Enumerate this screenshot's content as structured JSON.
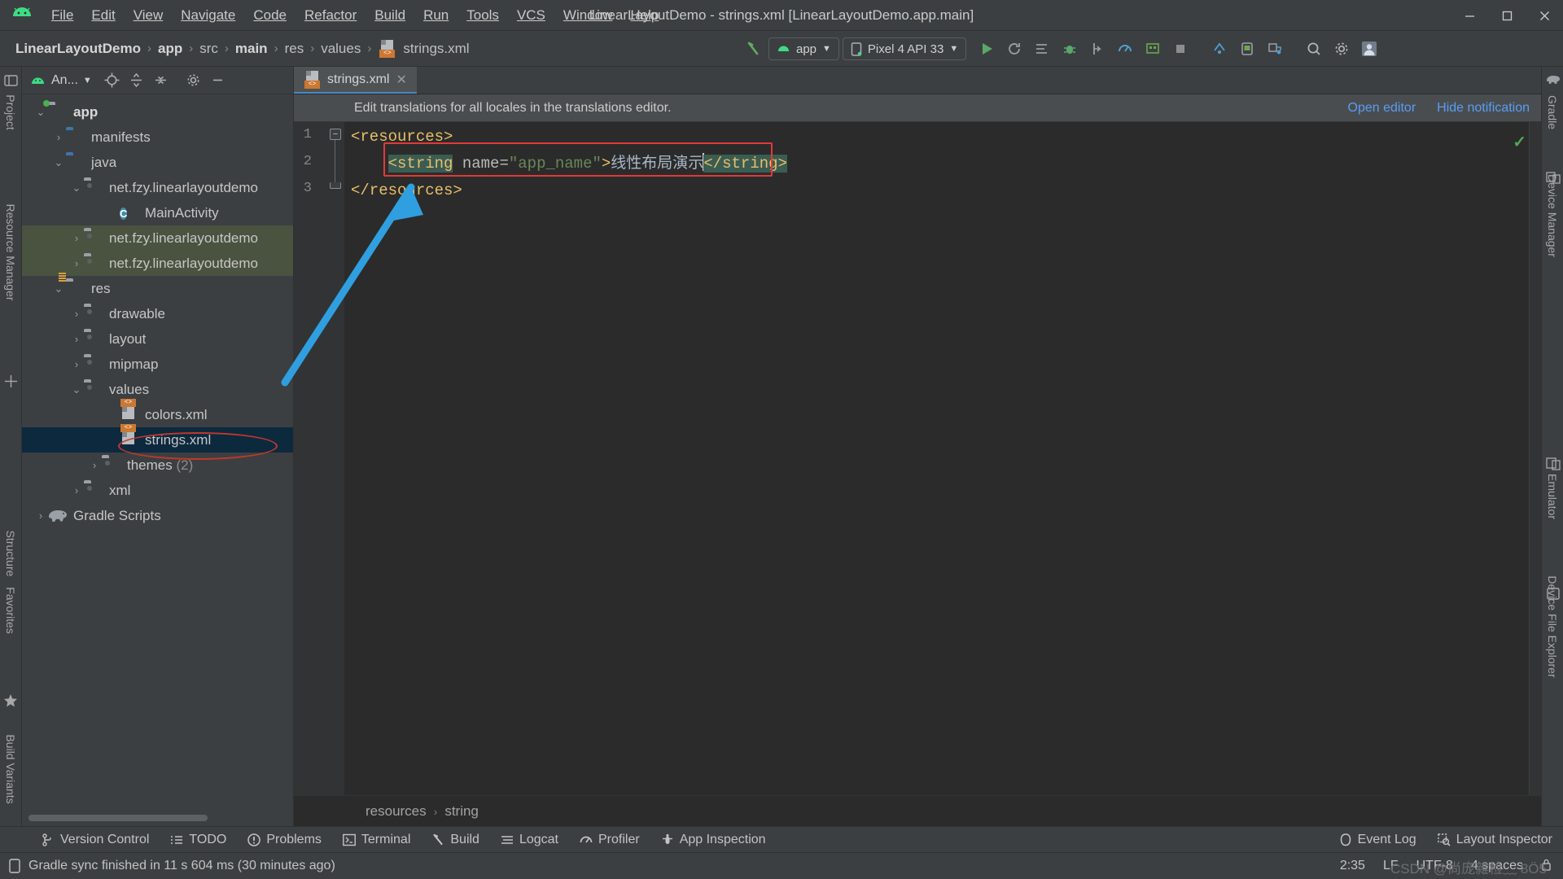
{
  "window": {
    "title": "LinearLayoutDemo - strings.xml [LinearLayoutDemo.app.main]",
    "minimize": "—",
    "maximize": "☐",
    "close": "✕"
  },
  "menu": {
    "items": [
      {
        "label": "File"
      },
      {
        "label": "Edit"
      },
      {
        "label": "View"
      },
      {
        "label": "Navigate"
      },
      {
        "label": "Code"
      },
      {
        "label": "Refactor"
      },
      {
        "label": "Build"
      },
      {
        "label": "Run"
      },
      {
        "label": "Tools"
      },
      {
        "label": "VCS"
      },
      {
        "label": "Window"
      },
      {
        "label": "Help"
      }
    ]
  },
  "breadcrumbs": {
    "items": [
      "LinearLayoutDemo",
      "app",
      "src",
      "main",
      "res",
      "values",
      "strings.xml"
    ],
    "separator": "›"
  },
  "toolbar": {
    "module_selector": "app",
    "device_selector": "Pixel 4 API 33",
    "dropdown_caret": "▼",
    "icons": [
      "build-hammer-icon",
      "run-icon",
      "apply-changes-icon",
      "apply-code-changes-icon",
      "debug-icon",
      "attach-debugger-icon",
      "profiler-icon",
      "device-explorer-icon",
      "stop-icon",
      "sdk-manager-icon",
      "avd-manager-icon",
      "sync-gradle-icon",
      "search-icon",
      "settings-gear-icon",
      "account-icon"
    ]
  },
  "project_panel": {
    "title": "An...",
    "header_icons": [
      "locate-icon",
      "expand-all-icon",
      "collapse-all-icon",
      "settings-gear-icon",
      "hide-icon"
    ],
    "tree": [
      {
        "label": "app",
        "indent": 0,
        "arrow": "⌄",
        "icon": "folder-app-icon",
        "bold": true,
        "selected": false,
        "group": false
      },
      {
        "label": "manifests",
        "indent": 1,
        "arrow": "›",
        "icon": "folder-blue-icon",
        "bold": false,
        "selected": false,
        "group": false
      },
      {
        "label": "java",
        "indent": 1,
        "arrow": "⌄",
        "icon": "folder-blue-icon",
        "bold": false,
        "selected": false,
        "group": false
      },
      {
        "label": "net.fzy.linearlayoutdemo",
        "indent": 2,
        "arrow": "⌄",
        "icon": "folder-package-icon",
        "bold": false,
        "selected": false,
        "group": false
      },
      {
        "label": "MainActivity",
        "indent": 4,
        "arrow": "",
        "icon": "java-class-icon",
        "bold": false,
        "selected": false,
        "group": false
      },
      {
        "label": "net.fzy.linearlayoutdemo",
        "indent": 2,
        "arrow": "›",
        "icon": "folder-package-icon",
        "bold": false,
        "selected": false,
        "group": true
      },
      {
        "label": "net.fzy.linearlayoutdemo",
        "indent": 2,
        "arrow": "›",
        "icon": "folder-package-icon",
        "bold": false,
        "selected": false,
        "group": true
      },
      {
        "label": "res",
        "indent": 1,
        "arrow": "⌄",
        "icon": "folder-res-icon",
        "bold": false,
        "selected": false,
        "group": false
      },
      {
        "label": "drawable",
        "indent": 2,
        "arrow": "›",
        "icon": "folder-package-icon",
        "bold": false,
        "selected": false,
        "group": false
      },
      {
        "label": "layout",
        "indent": 2,
        "arrow": "›",
        "icon": "folder-package-icon",
        "bold": false,
        "selected": false,
        "group": false
      },
      {
        "label": "mipmap",
        "indent": 2,
        "arrow": "›",
        "icon": "folder-package-icon",
        "bold": false,
        "selected": false,
        "group": false
      },
      {
        "label": "values",
        "indent": 2,
        "arrow": "⌄",
        "icon": "folder-package-icon",
        "bold": false,
        "selected": false,
        "group": false
      },
      {
        "label": "colors.xml",
        "indent": 4,
        "arrow": "",
        "icon": "xml-file-icon",
        "bold": false,
        "selected": false,
        "group": false
      },
      {
        "label": "strings.xml",
        "indent": 4,
        "arrow": "",
        "icon": "xml-file-icon",
        "bold": false,
        "selected": true,
        "group": false
      },
      {
        "label": "themes",
        "suffix": "(2)",
        "indent": 3,
        "arrow": "›",
        "icon": "folder-package-icon",
        "bold": false,
        "selected": false,
        "group": false
      },
      {
        "label": "xml",
        "indent": 2,
        "arrow": "›",
        "icon": "folder-package-icon",
        "bold": false,
        "selected": false,
        "group": false
      },
      {
        "label": "Gradle Scripts",
        "indent": 0,
        "arrow": "›",
        "icon": "gradle-elephant-icon",
        "bold": false,
        "selected": false,
        "group": false
      }
    ]
  },
  "left_strip": {
    "items": [
      "Project",
      "Resource Manager",
      "Structure",
      "Favorites",
      "Build Variants"
    ]
  },
  "right_strip": {
    "items": [
      "Gradle",
      "Device Manager",
      "Emulator",
      "Device File Explorer"
    ]
  },
  "editor": {
    "tab": {
      "label": "strings.xml",
      "close": "✕",
      "icon": "xml-file-icon"
    },
    "notification": {
      "message": "Edit translations for all locales in the translations editor.",
      "open_editor": "Open editor",
      "hide_notification": "Hide notification"
    },
    "lines": [
      {
        "num": "1"
      },
      {
        "num": "2"
      },
      {
        "num": "3"
      }
    ],
    "code": {
      "line1": "<resources>",
      "line2_tag_open": "<string",
      "line2_attr": " name=",
      "line2_attr_value": "\"app_name\"",
      "line2_gt": ">",
      "line2_text": "线性布局演示",
      "line2_tag_close": "</string>",
      "line3": "</resources>"
    },
    "breadcrumb": {
      "items": [
        "resources",
        "string"
      ],
      "separator": "›"
    },
    "inspection_status": "✓"
  },
  "bottom_tools": {
    "items": [
      {
        "label": "Version Control",
        "icon": "branch-icon"
      },
      {
        "label": "TODO",
        "icon": "todo-list-icon"
      },
      {
        "label": "Problems",
        "icon": "problems-icon"
      },
      {
        "label": "Terminal",
        "icon": "terminal-icon"
      },
      {
        "label": "Build",
        "icon": "build-hammer-icon"
      },
      {
        "label": "Logcat",
        "icon": "logcat-icon"
      },
      {
        "label": "Profiler",
        "icon": "profiler-icon"
      },
      {
        "label": "App Inspection",
        "icon": "app-inspection-icon"
      }
    ],
    "right_items": [
      {
        "label": "Event Log",
        "icon": "event-log-icon"
      },
      {
        "label": "Layout Inspector",
        "icon": "layout-inspector-icon"
      }
    ]
  },
  "statusbar": {
    "message": "Gradle sync finished in 11 s 604 ms (30 minutes ago)",
    "caret_position": "2:35",
    "line_separator": "LF",
    "encoding": "UTF-8",
    "indent": "4 spaces",
    "lock_icon": "lock-icon",
    "watermark": "CSDN @尚庞雜检﹏ 8Ö5"
  },
  "colors": {
    "accent_blue": "#589df6",
    "annotation_red": "#c0392b",
    "arrow_blue": "#2f9fe0",
    "selection_blue": "#0d293e",
    "tag_orange": "#e8bf6a",
    "string_green": "#6a8759",
    "editor_bg": "#2b2b2b",
    "chrome_bg": "#3c3f41"
  }
}
